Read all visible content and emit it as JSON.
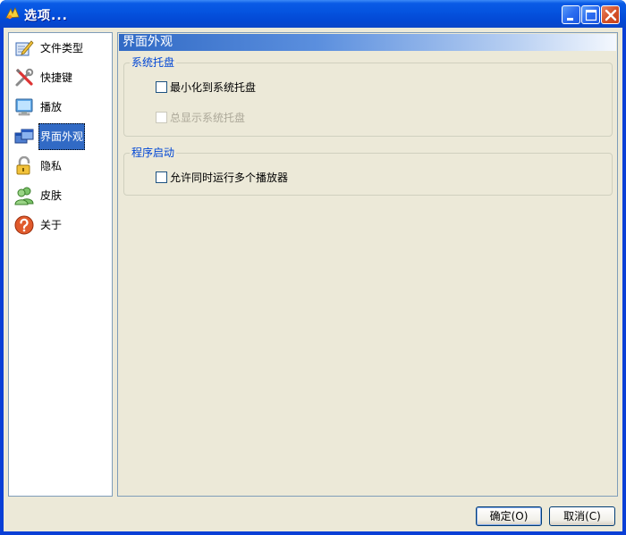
{
  "window": {
    "title": "选项..."
  },
  "nav": {
    "items": [
      {
        "label": "文件类型",
        "icon": "edit-document-icon"
      },
      {
        "label": "快捷键",
        "icon": "tools-icon"
      },
      {
        "label": "播放",
        "icon": "monitor-icon"
      },
      {
        "label": "界面外观",
        "icon": "windows-icon",
        "selected": true
      },
      {
        "label": "隐私",
        "icon": "padlock-icon"
      },
      {
        "label": "皮肤",
        "icon": "users-icon"
      },
      {
        "label": "关于",
        "icon": "help-icon"
      }
    ]
  },
  "panel": {
    "header": "界面外观",
    "tray_group": {
      "title": "系统托盘",
      "minimize_to_tray": {
        "label": "最小化到系统托盘",
        "checked": false
      },
      "always_show_tray": {
        "label": "总显示系统托盘",
        "checked": false,
        "disabled": true
      }
    },
    "startup_group": {
      "title": "程序启动",
      "allow_multiple": {
        "label": "允许同时运行多个播放器",
        "checked": false
      }
    }
  },
  "buttons": {
    "ok": "确定(O)",
    "cancel": "取消(C)"
  },
  "colors": {
    "titlebar": "#0554e0",
    "client_bg": "#ece9d8",
    "selection": "#316ac5",
    "group_title": "#0046d5"
  }
}
